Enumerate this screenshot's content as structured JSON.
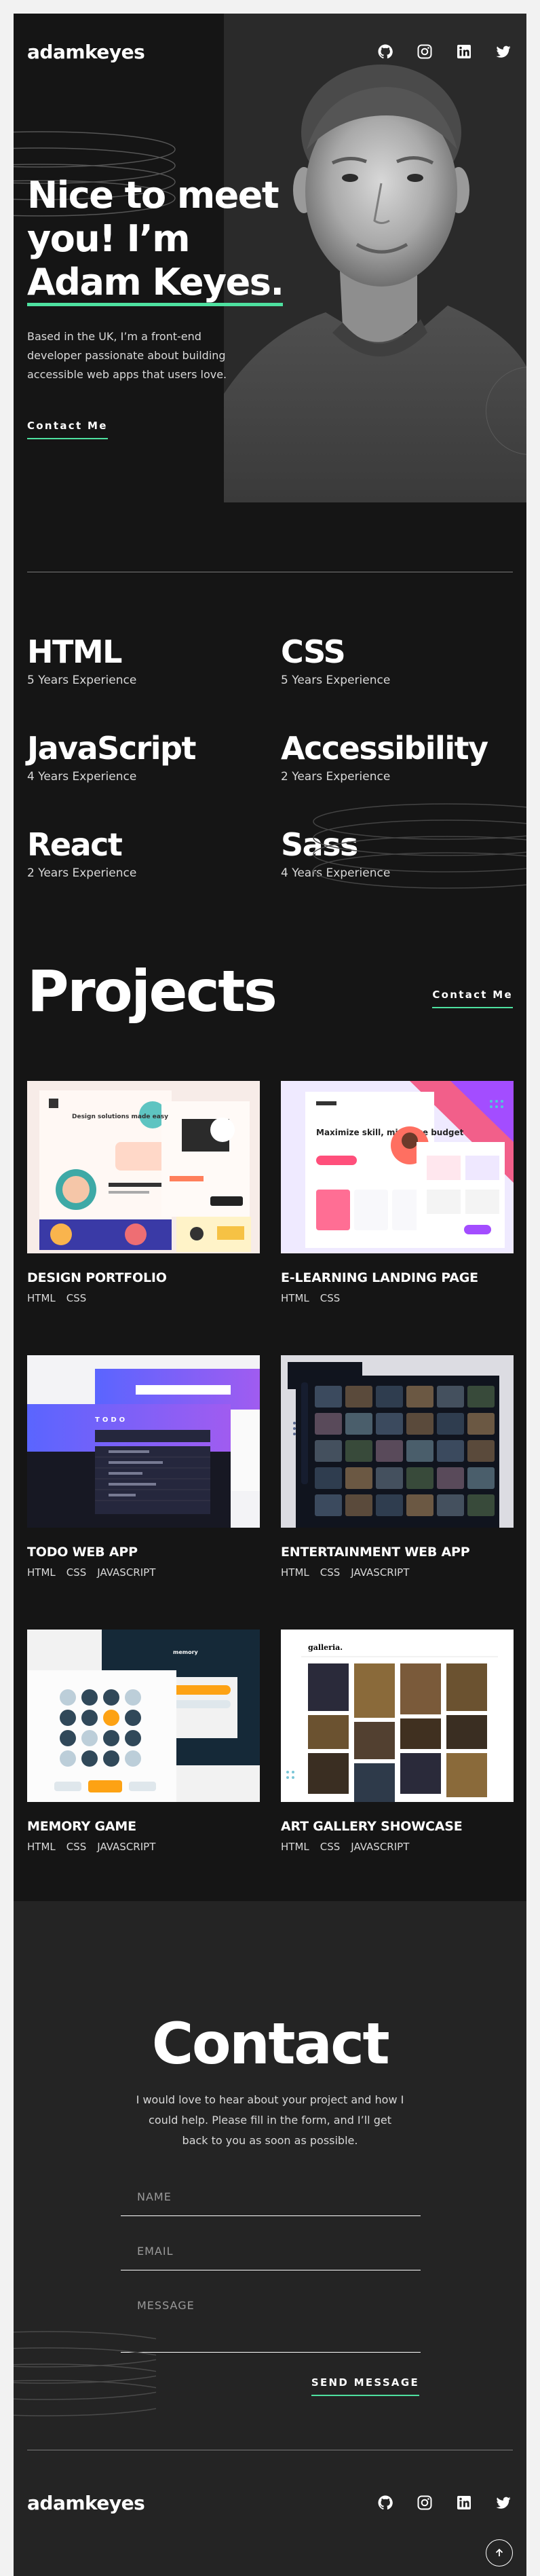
{
  "brand": {
    "logo": "adamkeyes",
    "accent": "#4ee1a0"
  },
  "socials": [
    {
      "name": "github-icon"
    },
    {
      "name": "instagram-icon"
    },
    {
      "name": "linkedin-icon"
    },
    {
      "name": "twitter-icon"
    }
  ],
  "hero": {
    "title_line1": "Nice to meet",
    "title_line2": "you! I’m",
    "title_name": "Adam Keyes.",
    "description": "Based in the UK, I’m a front-end developer passionate about building accessible web apps that users love.",
    "cta": "Contact Me"
  },
  "skills": [
    {
      "name": "HTML",
      "experience": "5 Years Experience"
    },
    {
      "name": "CSS",
      "experience": "5 Years Experience"
    },
    {
      "name": "JavaScript",
      "experience": "4 Years Experience"
    },
    {
      "name": "Accessibility",
      "experience": "2 Years Experience"
    },
    {
      "name": "React",
      "experience": "2 Years Experience"
    },
    {
      "name": "Sass",
      "experience": "4 Years Experience"
    }
  ],
  "projects": {
    "title": "Projects",
    "cta": "Contact Me",
    "items": [
      {
        "title": "DESIGN PORTFOLIO",
        "tags": [
          "HTML",
          "CSS"
        ],
        "thumb_text": "Design solutions made easy"
      },
      {
        "title": "E-LEARNING LANDING PAGE",
        "tags": [
          "HTML",
          "CSS"
        ],
        "thumb_text": "Maximize skill, minimize budget"
      },
      {
        "title": "TODO WEB APP",
        "tags": [
          "HTML",
          "CSS",
          "JAVASCRIPT"
        ],
        "thumb_text": "TODO"
      },
      {
        "title": "ENTERTAINMENT WEB APP",
        "tags": [
          "HTML",
          "CSS",
          "JAVASCRIPT"
        ],
        "thumb_text": ""
      },
      {
        "title": "MEMORY GAME",
        "tags": [
          "HTML",
          "CSS",
          "JAVASCRIPT"
        ],
        "thumb_text": "memory"
      },
      {
        "title": "ART GALLERY SHOWCASE",
        "tags": [
          "HTML",
          "CSS",
          "JAVASCRIPT"
        ],
        "thumb_text": "galleria."
      }
    ]
  },
  "contact": {
    "title": "Contact",
    "description": "I would love to hear about your project and how I could help. Please fill in the form, and I’ll get back to you as soon as possible.",
    "name_placeholder": "NAME",
    "email_placeholder": "EMAIL",
    "message_placeholder": "MESSAGE",
    "send": "SEND MESSAGE"
  },
  "footer": {
    "logo": "adamkeyes"
  }
}
